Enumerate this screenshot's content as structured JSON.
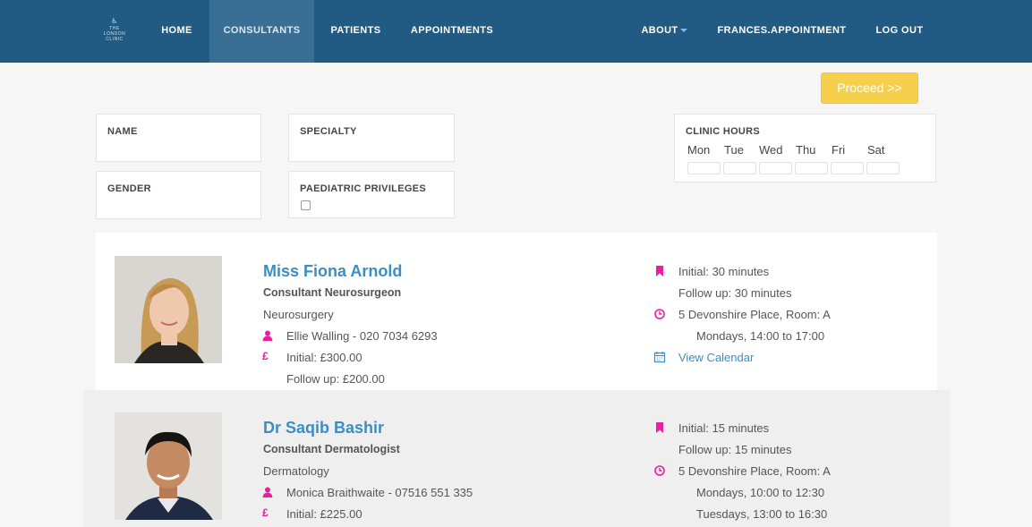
{
  "nav": {
    "logo_text": [
      "THE",
      "LONDON",
      "CLINIC"
    ],
    "items": [
      {
        "label": "HOME"
      },
      {
        "label": "CONSULTANTS"
      },
      {
        "label": "PATIENTS"
      },
      {
        "label": "APPOINTMENTS"
      },
      {
        "label": "ABOUT"
      },
      {
        "label": "FRANCES.APPOINTMENT"
      },
      {
        "label": "LOG OUT"
      }
    ],
    "active_item": "CONSULTANTS"
  },
  "proceed_button": {
    "label": "Proceed >>"
  },
  "filters": {
    "name": {
      "label": "NAME"
    },
    "specialty": {
      "label": "SPECIALTY"
    },
    "gender": {
      "label": "GENDER"
    },
    "paediatric": {
      "label": "PAEDIATRIC PRIVILEGES",
      "checked": false
    },
    "clinic_hours": {
      "label": "CLINIC HOURS",
      "days": [
        "Mon",
        "Tue",
        "Wed",
        "Thu",
        "Fri",
        "Sat"
      ]
    }
  },
  "consultants": [
    {
      "name": "Miss Fiona Arnold",
      "title": "Consultant Neurosurgeon",
      "specialty": "Neurosurgery",
      "secretary": "Ellie Walling - 020 7034 6293",
      "fee_initial": "Initial: £300.00",
      "fee_follow": "Follow up: £200.00",
      "duration_initial": "Initial: 30 minutes",
      "duration_follow": "Follow up: 30 minutes",
      "location": "5 Devonshire Place, Room: A",
      "sessions": [
        "Mondays, 14:00 to 17:00"
      ],
      "calendar_link": "View Calendar"
    },
    {
      "name": "Dr Saqib Bashir",
      "title": "Consultant Dermatologist",
      "specialty": "Dermatology",
      "secretary": "Monica Braithwaite - 07516 551 335",
      "fee_initial": "Initial: £225.00",
      "duration_initial": "Initial: 15 minutes",
      "duration_follow": "Follow up: 15 minutes",
      "location": "5 Devonshire Place, Room: A",
      "sessions": [
        "Mondays, 10:00 to 12:30",
        "Tuesdays, 13:00 to 16:30"
      ]
    }
  ],
  "colors": {
    "navbar": "#215b84",
    "nav_active": "#3a6f95",
    "proceed": "#f6cf4d",
    "link": "#3b8ec2",
    "icon_magenta": "#e91ea0"
  },
  "icons": [
    "bookmark-icon",
    "clock-icon",
    "calendar-icon",
    "user-icon",
    "pound-icon"
  ]
}
